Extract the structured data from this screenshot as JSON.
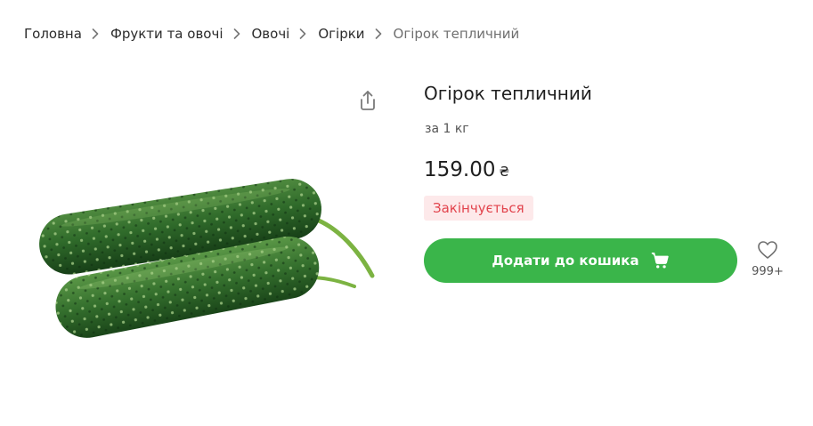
{
  "breadcrumb": {
    "items": [
      {
        "label": "Головна"
      },
      {
        "label": "Фрукти та овочі"
      },
      {
        "label": "Овочі"
      },
      {
        "label": "Огірки"
      }
    ],
    "current": "Огірок тепличний"
  },
  "product": {
    "title": "Огірок тепличний",
    "unit": "за 1 кг",
    "price": "159.00",
    "currency": "₴",
    "badge": "Закінчується",
    "add_to_cart_label": "Додати до кошика",
    "favorites_count": "999+",
    "image_alt": "cucumbers"
  },
  "icons": {
    "share": "share-icon",
    "cart": "cart-icon",
    "favorite": "heart-icon",
    "separator": "chevron-right-icon"
  },
  "colors": {
    "accent_green": "#3ab54a",
    "badge_bg": "#fde9ea",
    "badge_text": "#e2444d",
    "text": "#1f1f1f",
    "muted": "#6f6f6f"
  }
}
